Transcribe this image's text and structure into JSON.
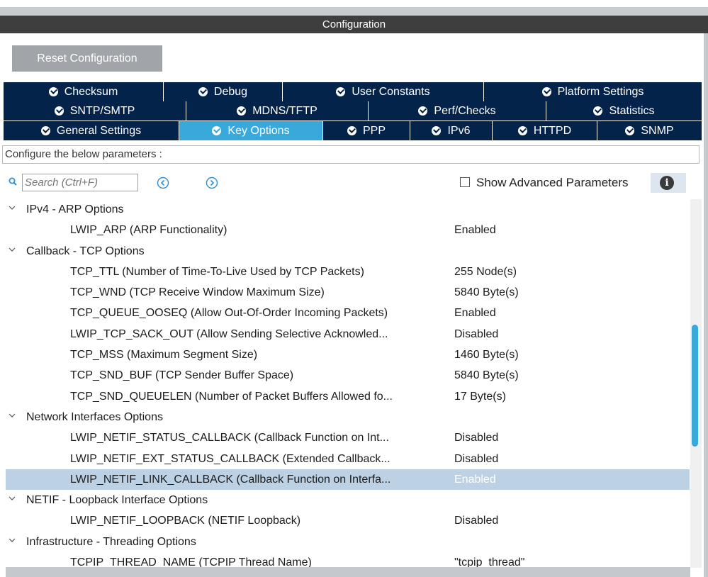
{
  "panel": {
    "title": "Configuration"
  },
  "toolbar": {
    "reset_label": "Reset Configuration"
  },
  "tabs": {
    "row1": [
      {
        "label": "Checksum"
      },
      {
        "label": "Debug"
      },
      {
        "label": "User Constants"
      },
      {
        "label": "Platform Settings"
      }
    ],
    "row2": [
      {
        "label": "SNTP/SMTP"
      },
      {
        "label": "MDNS/TFTP"
      },
      {
        "label": "Perf/Checks"
      },
      {
        "label": "Statistics"
      }
    ],
    "row3": [
      {
        "label": "General Settings"
      },
      {
        "label": "Key Options",
        "active": true
      },
      {
        "label": "PPP"
      },
      {
        "label": "IPv6"
      },
      {
        "label": "HTTPD"
      },
      {
        "label": "SNMP"
      }
    ]
  },
  "description": "Configure the below parameters :",
  "search": {
    "placeholder": "Search (Ctrl+F)"
  },
  "advanced": {
    "label": "Show Advanced Parameters",
    "checked": false
  },
  "colors": {
    "tab_bg": "#03234b",
    "tab_active": "#39a9dc",
    "selected_row": "#bcd1e4",
    "title_bar": "#3e3e3e"
  },
  "tree": [
    {
      "type": "group",
      "name": "IPv4 - ARP Options"
    },
    {
      "type": "param",
      "name": "LWIP_ARP (ARP Functionality)",
      "value": "Enabled"
    },
    {
      "type": "group",
      "name": "Callback - TCP Options"
    },
    {
      "type": "param",
      "name": "TCP_TTL (Number of Time-To-Live Used by TCP Packets)",
      "value": "255 Node(s)"
    },
    {
      "type": "param",
      "name": "TCP_WND (TCP Receive Window Maximum Size)",
      "value": "5840 Byte(s)"
    },
    {
      "type": "param",
      "name": "TCP_QUEUE_OOSEQ (Allow Out-Of-Order Incoming Packets)",
      "value": "Enabled"
    },
    {
      "type": "param",
      "name": "LWIP_TCP_SACK_OUT (Allow Sending Selective Acknowled...",
      "value": "Disabled"
    },
    {
      "type": "param",
      "name": "TCP_MSS (Maximum Segment Size)",
      "value": "1460 Byte(s)"
    },
    {
      "type": "param",
      "name": "TCP_SND_BUF (TCP Sender Buffer Space)",
      "value": "5840 Byte(s)"
    },
    {
      "type": "param",
      "name": "TCP_SND_QUEUELEN (Number of Packet Buffers Allowed fo...",
      "value": "17 Byte(s)"
    },
    {
      "type": "group",
      "name": "Network Interfaces Options"
    },
    {
      "type": "param",
      "name": "LWIP_NETIF_STATUS_CALLBACK (Callback Function on Int...",
      "value": "Disabled"
    },
    {
      "type": "param",
      "name": "LWIP_NETIF_EXT_STATUS_CALLBACK (Extended Callback...",
      "value": "Disabled"
    },
    {
      "type": "param",
      "name": "LWIP_NETIF_LINK_CALLBACK (Callback Function on Interfa...",
      "value": "Enabled",
      "selected": true
    },
    {
      "type": "group",
      "name": "NETIF - Loopback Interface Options"
    },
    {
      "type": "param",
      "name": "LWIP_NETIF_LOOPBACK (NETIF Loopback)",
      "value": "Disabled"
    },
    {
      "type": "group",
      "name": "Infrastructure - Threading Options"
    },
    {
      "type": "param",
      "name": "TCPIP_THREAD_NAME (TCPIP Thread Name)",
      "value": "\"tcpip_thread\""
    }
  ]
}
